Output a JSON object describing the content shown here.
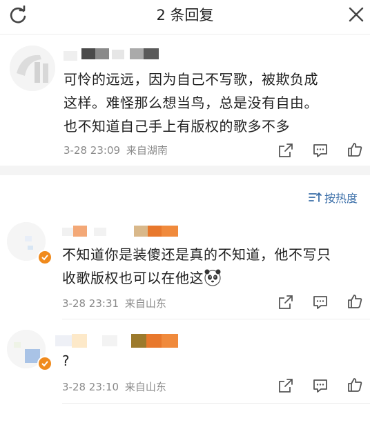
{
  "header": {
    "title": "2 条回复"
  },
  "sort": {
    "label": "按热度"
  },
  "main_comment": {
    "text_line1": "可怜的远远，因为自己不写歌，被欺负成",
    "text_line2": "这样。难怪那么想当鸟，总是没有自由。",
    "text_line3": "也不知道自己手上有版权的歌多不多",
    "time": "3-28 23:09",
    "location": "来自湖南"
  },
  "replies": [
    {
      "text_line1": "不知道你是装傻还是真的不知道，他不写只",
      "text_line2": "收歌版权也可以在他这",
      "time": "3-28 23:31",
      "location": "来自山东"
    },
    {
      "text_line1": "?",
      "time": "3-28 23:10",
      "location": "来自山东"
    }
  ],
  "colors": {
    "accent_blue": "#3a6ea8",
    "badge_orange": "#f08a1c",
    "meta_gray": "#8a8a8a"
  }
}
